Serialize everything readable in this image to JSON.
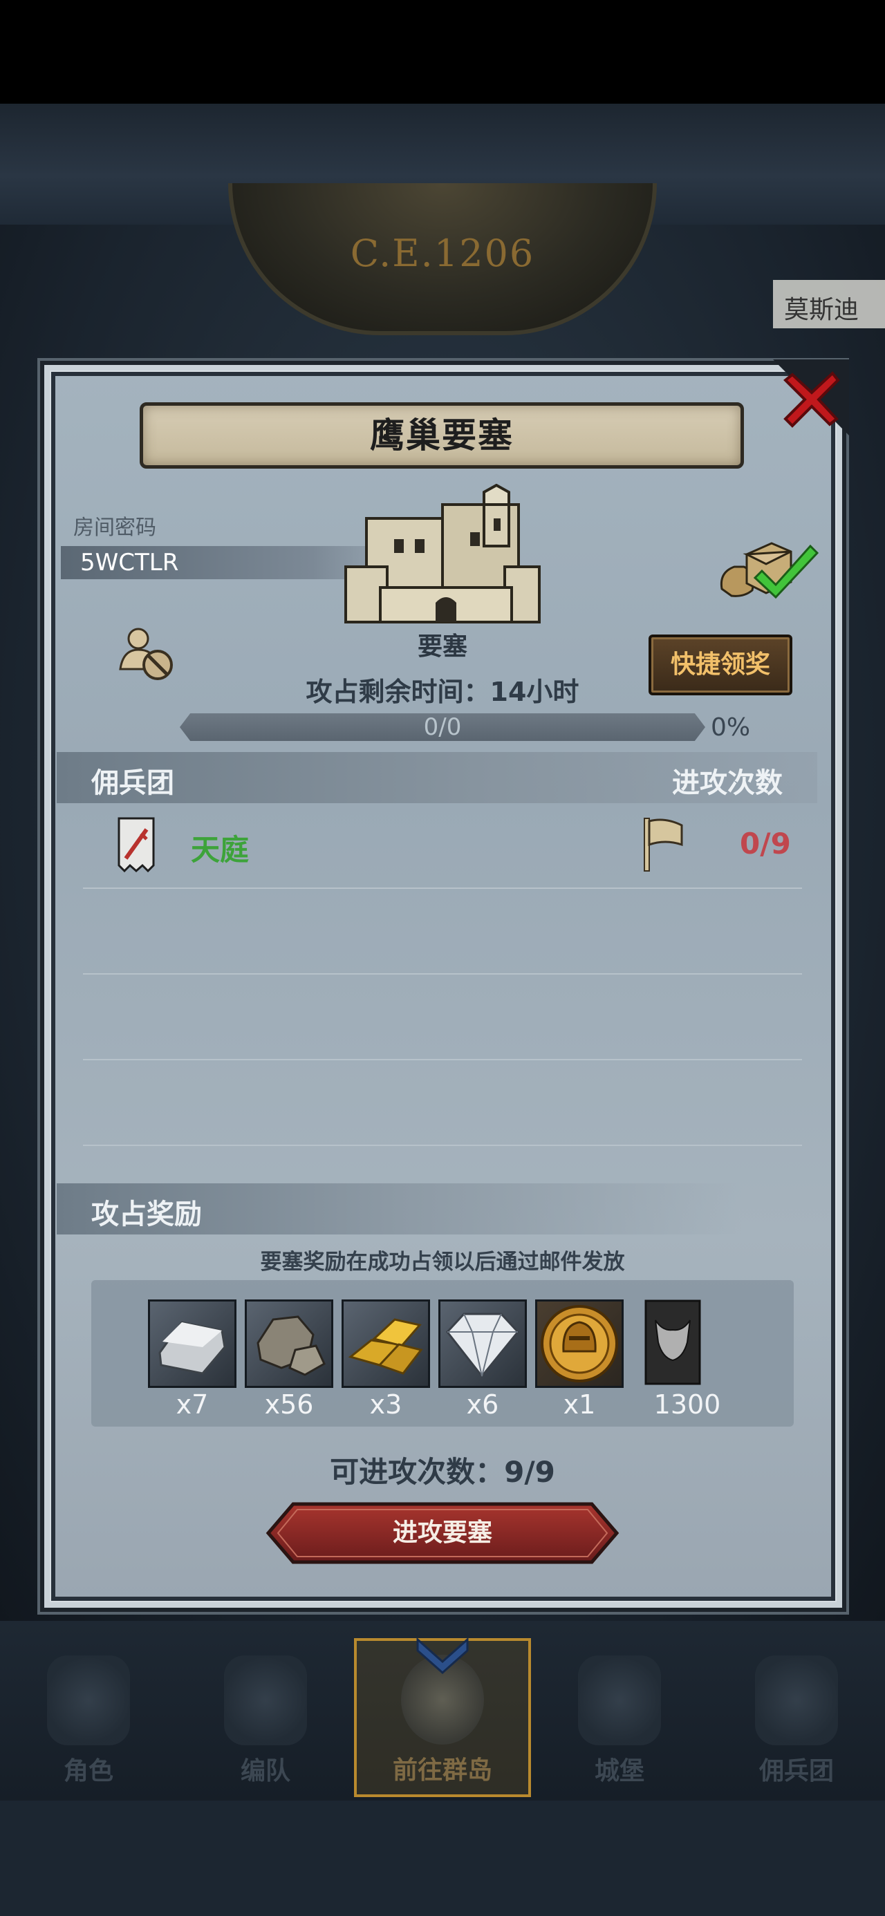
{
  "scene": {
    "era": "C.E.1206",
    "city_label": "莫斯迪"
  },
  "dialog": {
    "title": "鹰巢要塞",
    "room_label": "房间密码",
    "room_code": "5WCTLR",
    "fortress_name": "要塞",
    "quick_claim_label": "快捷领奖",
    "time_remaining": "攻占剩余时间：14小时",
    "progress": {
      "text": "0/0",
      "percent_label": "0%",
      "fraction": 0
    },
    "mercenary_header": "佣兵团",
    "attack_count_header": "进攻次数",
    "mercenaries": [
      {
        "name": "天庭",
        "attacks": "0/9",
        "name_color": "#3da33a"
      }
    ],
    "reward_header": "攻占奖励",
    "reward_note": "要塞奖励在成功占领以后通过邮件发放",
    "rewards": [
      {
        "icon": "silver-ingot-icon",
        "qty": "x7"
      },
      {
        "icon": "stone-ore-icon",
        "qty": "x56"
      },
      {
        "icon": "gold-bars-icon",
        "qty": "x3"
      },
      {
        "icon": "diamond-icon",
        "qty": "x6"
      },
      {
        "icon": "knight-medal-icon",
        "qty": "x1"
      },
      {
        "icon": "bull-banner-icon",
        "qty": "1300"
      }
    ],
    "available_attacks": "可进攻次数：9/9",
    "attack_button_label": "进攻要塞"
  },
  "nav": {
    "items": [
      {
        "label": "角色",
        "icon": "knight-helmet-icon"
      },
      {
        "label": "编队",
        "icon": "formation-icon"
      },
      {
        "label": "前往群岛",
        "icon": "islands-globe-icon",
        "active": true
      },
      {
        "label": "城堡",
        "icon": "castle-icon"
      },
      {
        "label": "佣兵团",
        "icon": "mercenary-ship-icon"
      }
    ]
  },
  "colors": {
    "accent_gold": "#c9a44e",
    "attack_button": "#8e2a2a",
    "close_red": "#c0181c",
    "merc_attacks": "#c0474e"
  }
}
